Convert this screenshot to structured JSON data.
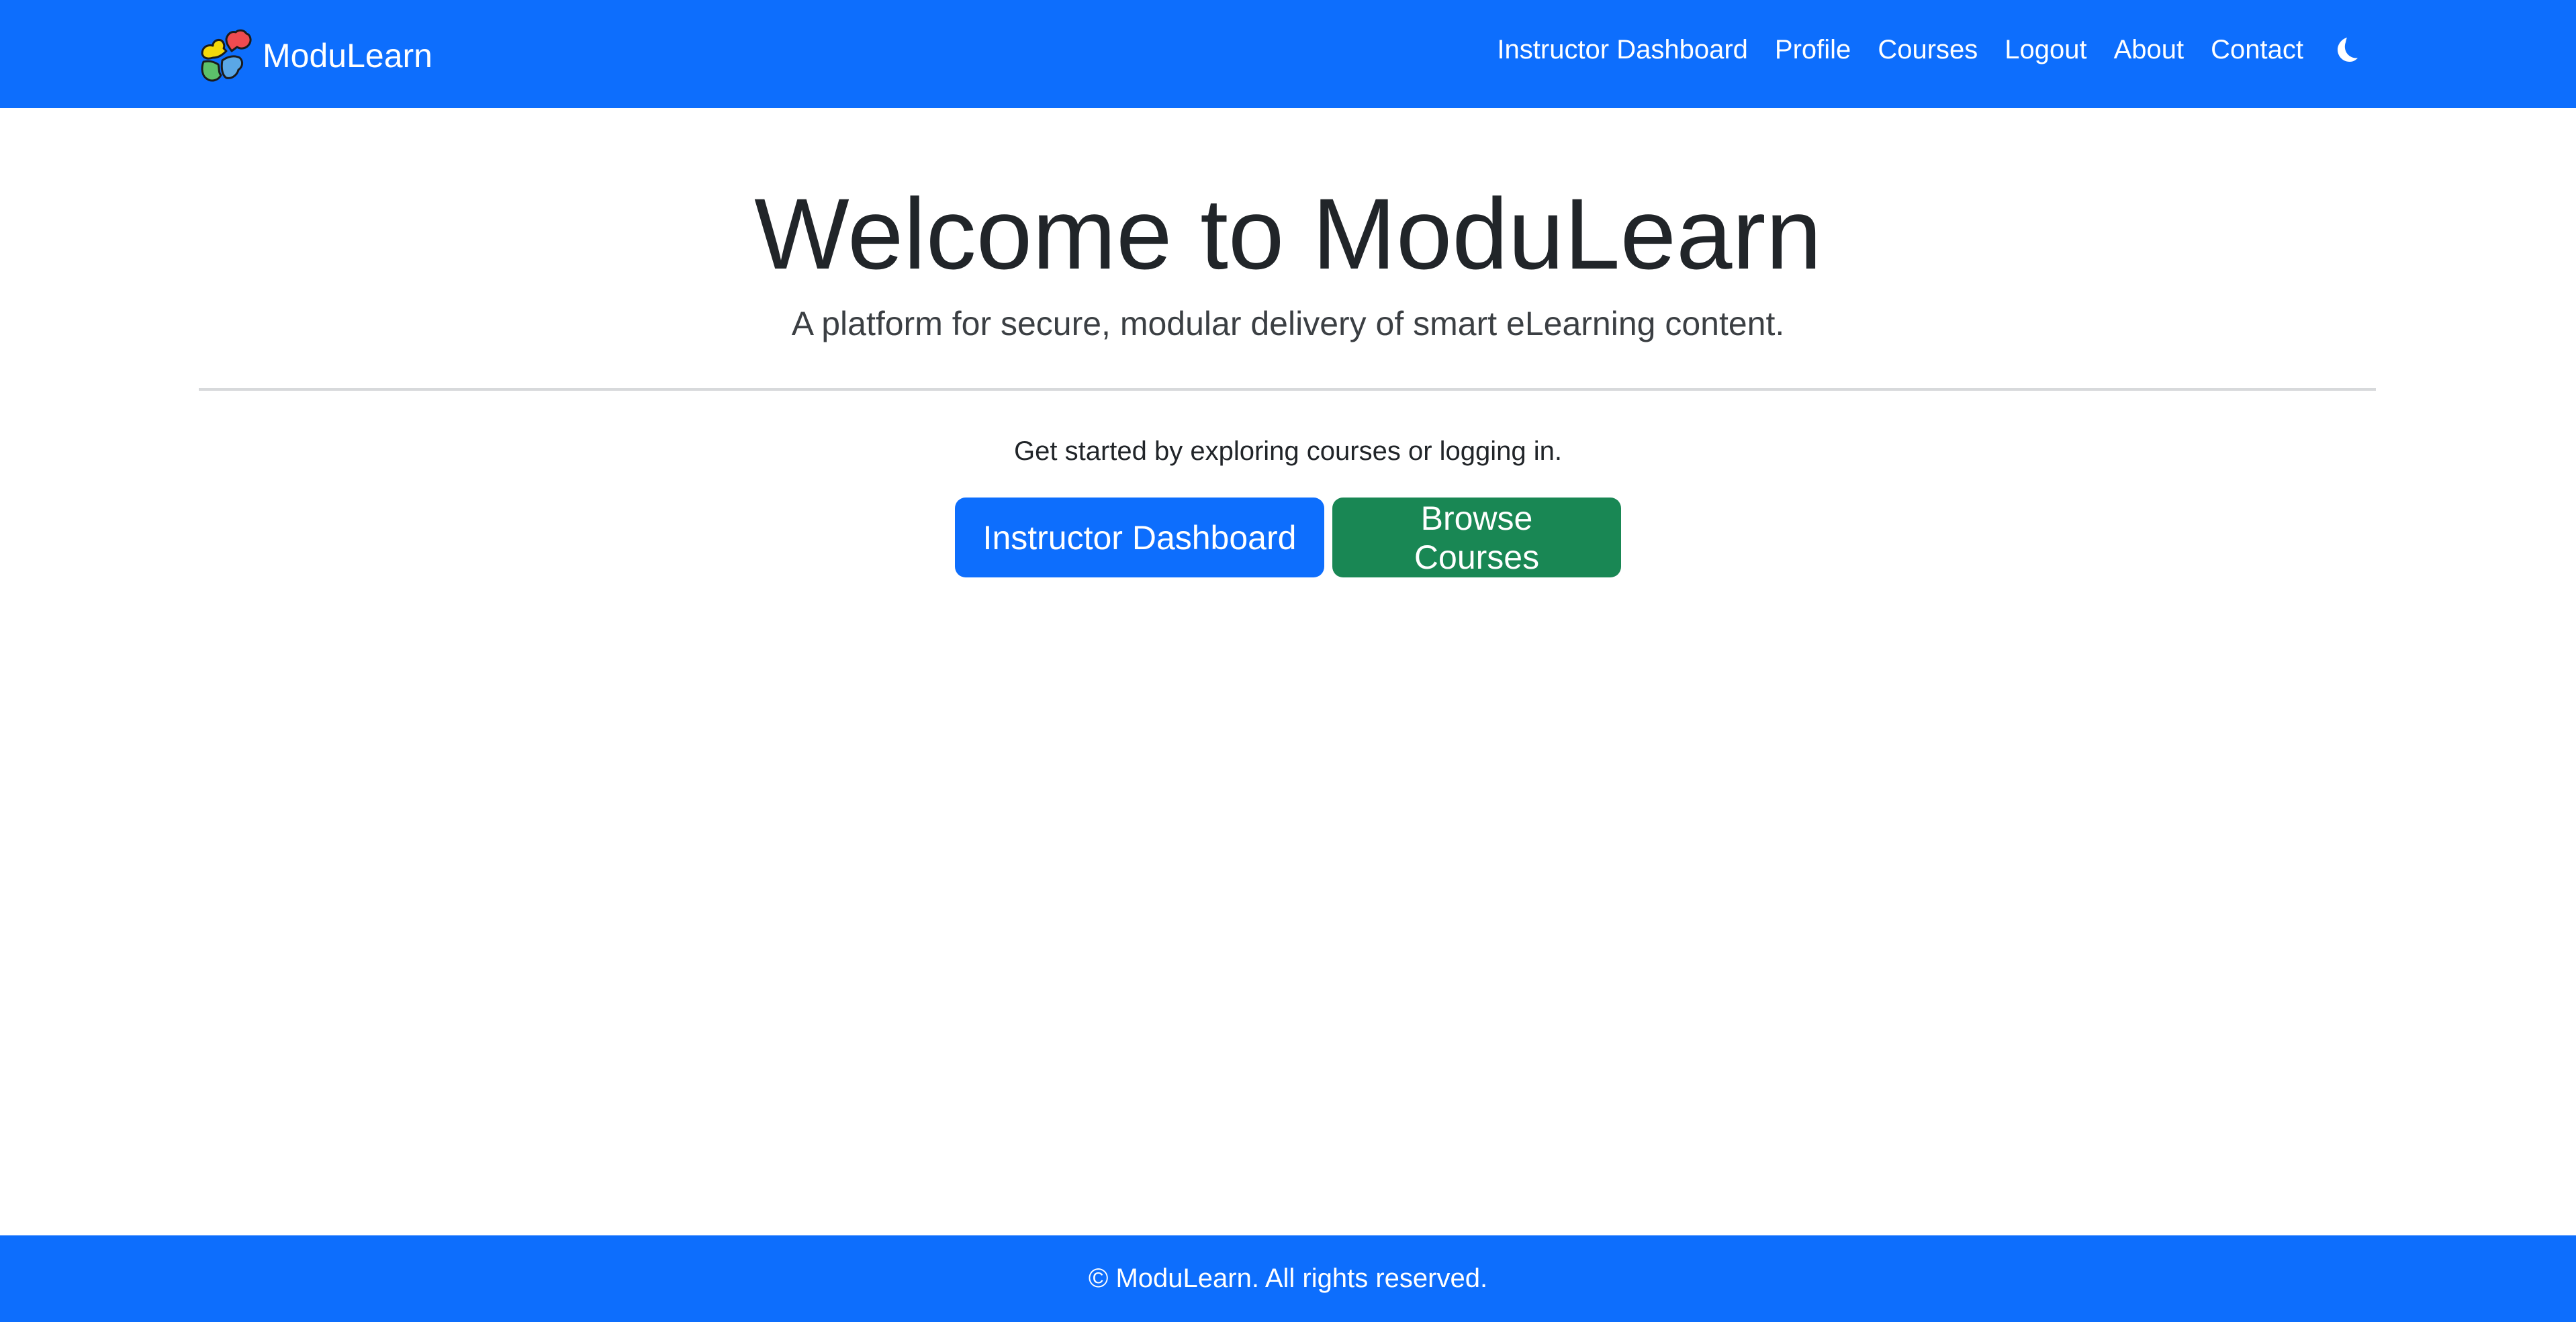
{
  "colors": {
    "brand_blue": "#0d6efd",
    "success_green": "#198754",
    "text_dark": "#212529",
    "white": "#ffffff"
  },
  "navbar": {
    "brand_name": "ModuLearn",
    "brand_icon": "puzzle-logo-icon",
    "links": [
      {
        "label": "Instructor Dashboard"
      },
      {
        "label": "Profile"
      },
      {
        "label": "Courses"
      },
      {
        "label": "Logout"
      },
      {
        "label": "About"
      },
      {
        "label": "Contact"
      }
    ],
    "theme_toggle_icon": "moon-icon"
  },
  "hero": {
    "title": "Welcome to ModuLearn",
    "subtitle": "A platform for secure, modular delivery of smart eLearning content."
  },
  "main": {
    "lead": "Get started by exploring courses or logging in.",
    "buttons": {
      "instructor_dashboard": "Instructor Dashboard",
      "browse_courses": "Browse Courses"
    }
  },
  "footer": {
    "text": "© ModuLearn. All rights reserved."
  }
}
